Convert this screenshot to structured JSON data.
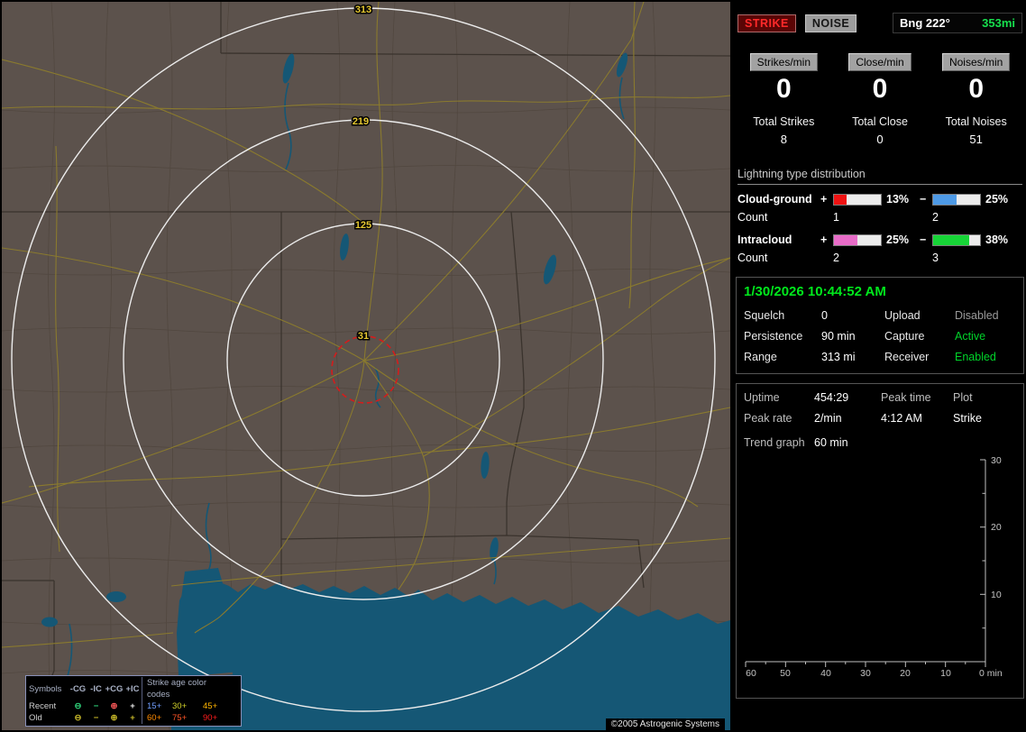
{
  "colors": {
    "accent_green": "#00e81c",
    "strike_red": "#ff2a2a",
    "map_land": "#5c524c",
    "map_water": "#155775",
    "ring_label_yellow": "#e6c832",
    "bar_plus_cg": "#ee1212",
    "bar_minus_cg": "#4e9ae6",
    "bar_plus_ic": "#e86cc8",
    "bar_minus_ic": "#17d437"
  },
  "map": {
    "ring_labels": [
      "313",
      "219",
      "125",
      "31"
    ],
    "legend": {
      "symbols_header": "Symbols",
      "col_headers": [
        "-CG",
        "-IC",
        "+CG",
        "+IC"
      ],
      "age_header": "Strike age color codes",
      "glyphs": [
        "⊖",
        "−",
        "⊕",
        "+"
      ],
      "rows": [
        {
          "label": "Recent",
          "ages": [
            "15+",
            "30+",
            "45+"
          ]
        },
        {
          "label": "Old",
          "ages": [
            "60+",
            "75+",
            "90+"
          ]
        }
      ]
    },
    "copyright": "©2005 Astrogenic Systems"
  },
  "panel": {
    "indicators": {
      "strike": "STRIKE",
      "noise": "NOISE",
      "bearing": "Bng 222°",
      "distance": "353mi"
    },
    "rates": [
      {
        "header": "Strikes/min",
        "value": "0",
        "total_label": "Total Strikes",
        "total_value": "8"
      },
      {
        "header": "Close/min",
        "value": "0",
        "total_label": "Total Close",
        "total_value": "0"
      },
      {
        "header": "Noises/min",
        "value": "0",
        "total_label": "Total Noises",
        "total_value": "51"
      }
    ],
    "distribution": {
      "title": "Lightning type distribution",
      "rows": [
        {
          "label": "Cloud-ground",
          "plus_sign": "+",
          "plus_pct": "13%",
          "plus_fill": "26%",
          "minus_sign": "−",
          "minus_pct": "25%",
          "minus_fill": "50%",
          "count_label": "Count",
          "plus_count": "1",
          "minus_count": "2"
        },
        {
          "label": "Intracloud",
          "plus_sign": "+",
          "plus_pct": "25%",
          "plus_fill": "50%",
          "minus_sign": "−",
          "minus_pct": "38%",
          "minus_fill": "76%",
          "count_label": "Count",
          "plus_count": "2",
          "minus_count": "3"
        }
      ]
    },
    "datetime": "1/30/2026 10:44:52 AM",
    "status_rows": [
      {
        "label1": "Squelch",
        "value1": "0",
        "label2": "Upload",
        "value2": "Disabled"
      },
      {
        "label1": "Persistence",
        "value1": "90 min",
        "label2": "Capture",
        "value2": "Active"
      },
      {
        "label1": "Range",
        "value1": "313 mi",
        "label2": "Receiver",
        "value2": "Enabled"
      }
    ],
    "stats": {
      "uptime_label": "Uptime",
      "uptime_value": "454:29",
      "peaktime_label": "Peak time",
      "plot_label": "Plot",
      "peakrate_label": "Peak rate",
      "peakrate_value": "2/min",
      "peaktime_value": "4:12 AM",
      "plot_value": "Strike",
      "trend_label": "Trend graph",
      "trend_value": "60 min"
    },
    "trend_graph": {
      "type": "line",
      "series": [],
      "x_ticks": [
        "60",
        "50",
        "40",
        "30",
        "20",
        "10"
      ],
      "x_origin_label": "0 min",
      "y_ticks": [
        "30",
        "20",
        "10"
      ],
      "x_range": [
        60,
        0
      ],
      "y_range": [
        0,
        30
      ]
    }
  }
}
